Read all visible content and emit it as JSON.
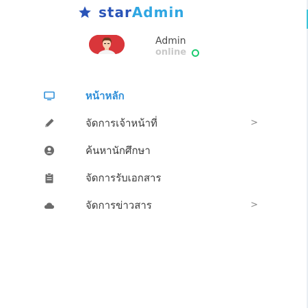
{
  "brand": {
    "star_word": "star",
    "admin_word": "Admin",
    "icon": "star-icon"
  },
  "profile": {
    "name": "Admin",
    "status": "online",
    "status_color": "#1ccb6f"
  },
  "menu": {
    "items": [
      {
        "label": "หน้าหลัก",
        "icon": "monitor-icon",
        "active": true,
        "has_submenu": false
      },
      {
        "label": "จัดการเจ้าหน้าที่",
        "icon": "pencil-icon",
        "active": false,
        "has_submenu": true,
        "chevron": ">"
      },
      {
        "label": "ค้นหานักศึกษา",
        "icon": "user-circle-icon",
        "active": false,
        "has_submenu": false
      },
      {
        "label": "จัดการรับเอกสาร",
        "icon": "clipboard-icon",
        "active": false,
        "has_submenu": false
      },
      {
        "label": "จัดการข่าวสาร",
        "icon": "cloud-icon",
        "active": false,
        "has_submenu": true,
        "chevron": ">"
      }
    ]
  },
  "colors": {
    "brand_star": "#2a54b8",
    "brand_admin": "#2fa6e2",
    "active_menu": "#2f8fd9",
    "menu_text": "#3a3a3a",
    "icon_gray": "#6b6b6b"
  }
}
